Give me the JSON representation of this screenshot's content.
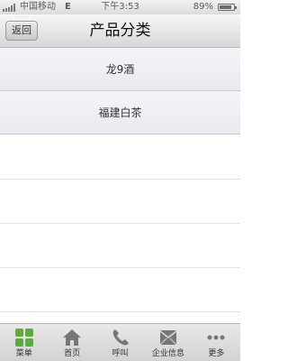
{
  "status_bar": {
    "carrier": "中国移动",
    "network": "E",
    "time": "下午3:53",
    "battery_percent_text": "89%",
    "battery_level": 0.89
  },
  "nav": {
    "back_label": "返回",
    "title": "产品分类"
  },
  "categories": [
    {
      "label": "龙9酒"
    },
    {
      "label": "福建白茶"
    }
  ],
  "tabbar": {
    "items": [
      {
        "label": "菜单",
        "icon": "grid-icon"
      },
      {
        "label": "首页",
        "icon": "home-icon"
      },
      {
        "label": "呼叫",
        "icon": "phone-icon"
      },
      {
        "label": "企业信息",
        "icon": "mail-icon"
      },
      {
        "label": "更多",
        "icon": "more-icon"
      }
    ]
  },
  "colors": {
    "menu_icon_green": "#5cab3c",
    "tab_icon_gray": "#777777"
  }
}
